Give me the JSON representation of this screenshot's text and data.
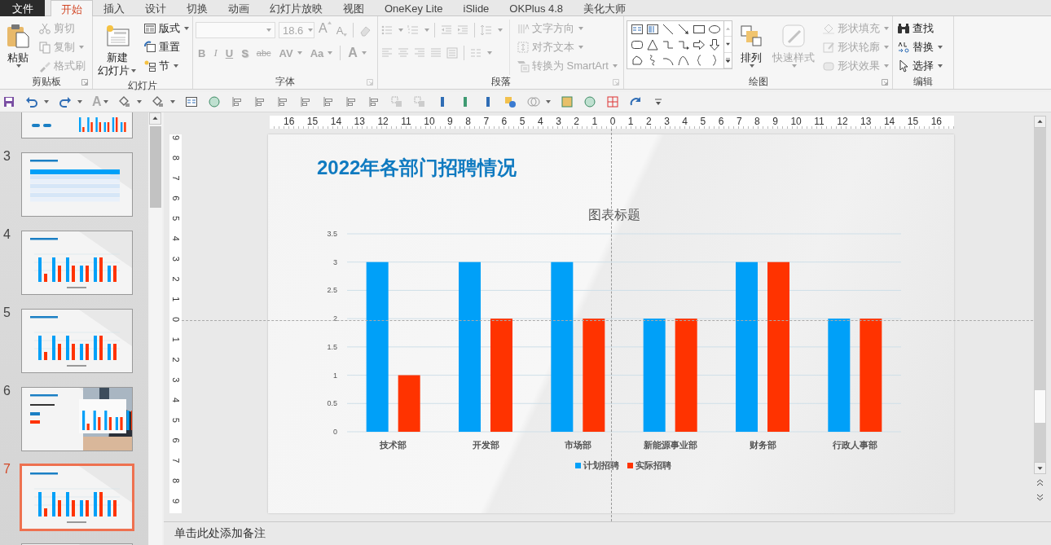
{
  "ribbon_tabs": [
    {
      "label": "文件",
      "kind": "file",
      "selected": false
    },
    {
      "label": "开始",
      "kind": "tab",
      "selected": true
    },
    {
      "label": "插入",
      "kind": "tab",
      "selected": false
    },
    {
      "label": "设计",
      "kind": "tab",
      "selected": false
    },
    {
      "label": "切换",
      "kind": "tab",
      "selected": false
    },
    {
      "label": "动画",
      "kind": "tab",
      "selected": false
    },
    {
      "label": "幻灯片放映",
      "kind": "tab",
      "selected": false
    },
    {
      "label": "视图",
      "kind": "tab",
      "selected": false
    },
    {
      "label": "OneKey Lite",
      "kind": "tab",
      "selected": false
    },
    {
      "label": "iSlide",
      "kind": "tab",
      "selected": false
    },
    {
      "label": "OKPlus 4.8",
      "kind": "tab",
      "selected": false
    },
    {
      "label": "美化大师",
      "kind": "tab",
      "selected": false
    }
  ],
  "ribbon": {
    "clipboard": {
      "label": "剪贴板",
      "items": [
        {
          "label": "粘贴",
          "disabled": false
        },
        {
          "label": "剪切",
          "disabled": true
        },
        {
          "label": "复制",
          "disabled": true
        },
        {
          "label": "格式刷",
          "disabled": true
        }
      ]
    },
    "slides": {
      "label": "幻灯片",
      "new_slide": [
        "新建",
        "幻灯片"
      ],
      "items": [
        "版式",
        "重置",
        "节"
      ]
    },
    "font": {
      "label": "字体",
      "disabled": true,
      "size": "18.6",
      "grow": "A",
      "shrink": "A",
      "styles": [
        "B",
        "I",
        "U",
        "S",
        "abc",
        "AV",
        "Aa"
      ],
      "font_color_button": "A"
    },
    "paragraph": {
      "label": "段落",
      "disabled": true,
      "items": [
        "文字方向",
        "对齐文本",
        "转换为 SmartArt"
      ]
    },
    "drawing": {
      "label": "绘图",
      "arrange": {
        "label": "排列",
        "disabled": false
      },
      "quick_styles": {
        "label": "快速样式",
        "disabled": true
      },
      "items": [
        {
          "label": "形状填充",
          "disabled": true
        },
        {
          "label": "形状轮廓",
          "disabled": true
        },
        {
          "label": "形状效果",
          "disabled": true
        }
      ]
    },
    "editing": {
      "label": "编辑",
      "items": [
        "查找",
        "替换",
        "选择"
      ]
    }
  },
  "quick_access": [
    {
      "kind": "save"
    },
    {
      "kind": "undo"
    },
    {
      "kind": "redo"
    },
    {
      "kind": "font-color",
      "label": "A"
    },
    {
      "kind": "diamond"
    },
    {
      "kind": "diamond"
    },
    {
      "kind": "textbox"
    },
    {
      "kind": "circle"
    },
    {
      "kind": "align"
    },
    {
      "kind": "align"
    },
    {
      "kind": "align"
    },
    {
      "kind": "align"
    },
    {
      "kind": "align"
    },
    {
      "kind": "align"
    },
    {
      "kind": "align"
    },
    {
      "kind": "squares"
    },
    {
      "kind": "squares"
    },
    {
      "kind": "bar",
      "color": "#2f6db5"
    },
    {
      "kind": "bar",
      "color": "#3f9a72"
    },
    {
      "kind": "bar",
      "color": "#2f6db5"
    },
    {
      "kind": "shapes"
    },
    {
      "kind": "circles"
    },
    {
      "kind": "square"
    },
    {
      "kind": "circle"
    },
    {
      "kind": "crop"
    },
    {
      "kind": "arrow"
    },
    {
      "kind": "more"
    }
  ],
  "slides": [
    {
      "kind": "partial",
      "selected": false
    },
    {
      "number": "3",
      "kind": "table",
      "selected": false
    },
    {
      "number": "4",
      "kind": "chart",
      "selected": false
    },
    {
      "number": "5",
      "kind": "chart",
      "selected": false
    },
    {
      "number": "6",
      "kind": "photo",
      "selected": false
    },
    {
      "number": "7",
      "kind": "chart",
      "selected": true
    },
    {
      "kind": "blank",
      "selected": false
    }
  ],
  "rulers": {
    "horizontal": "16 15 14 13 12 11 10 9 8 7 6 5 4 3 2 1 0 1 2 3 4 5 6 7 8 9 10 11 12 13 14 15 16",
    "vertical": "9 8 7 6 5 4 3 2 1 0 1 2 3 4 5 6 7 8 9"
  },
  "slide": {
    "title": "2022年各部门招聘情况",
    "chart": {
      "chart_data": {
        "type": "bar",
        "title": "图表标题",
        "categories": [
          "技术部",
          "开发部",
          "市场部",
          "新能源事业部",
          "财务部",
          "行政人事部"
        ],
        "series": [
          {
            "name": "计划招聘",
            "color": "#00a0f8",
            "values": [
              3,
              3,
              3,
              2,
              3,
              2
            ]
          },
          {
            "name": "实际招聘",
            "color": "#ff3300",
            "values": [
              1,
              2,
              2,
              2,
              3,
              2
            ]
          }
        ],
        "ylim": [
          0,
          3.5
        ],
        "yticks": [
          0,
          0.5,
          1,
          1.5,
          2,
          2.5,
          3,
          3.5
        ],
        "grid": true,
        "legend": true
      }
    }
  },
  "notes": {
    "placeholder": "单击此处添加备注"
  }
}
